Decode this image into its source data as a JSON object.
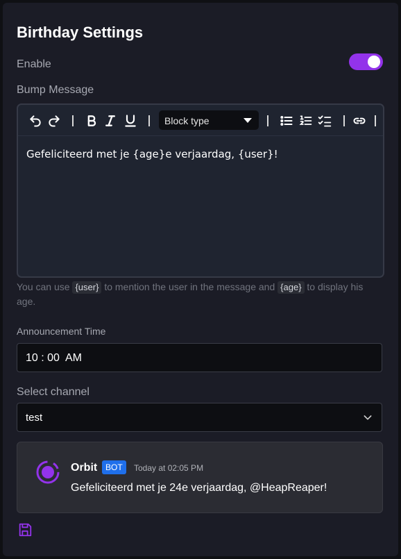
{
  "title": "Birthday Settings",
  "enable": {
    "label": "Enable",
    "on": true
  },
  "bump_message": {
    "label": "Bump Message",
    "toolbar": {
      "block_type": "Block type"
    },
    "content": "Gefeliciteerd met je {age}e verjaardag, {user}!"
  },
  "help": {
    "p1": "You can use ",
    "code1": "{user}",
    "p2": " to mention the user in the message and ",
    "code2": "{age}",
    "p3": " to display his age."
  },
  "announcement_time": {
    "label": "Announcement Time",
    "value": "10 : 00  AM"
  },
  "select_channel": {
    "label": "Select channel",
    "value": "test"
  },
  "preview": {
    "bot_name": "Orbit",
    "badge": "BOT",
    "time": "Today at 02:05 PM",
    "message": "Gefeliciteerd met je 24e verjaardag, @HeapReaper!"
  },
  "colors": {
    "accent": "#9333ea",
    "badge": "#1f6feb",
    "panel": "#1b1c26"
  }
}
